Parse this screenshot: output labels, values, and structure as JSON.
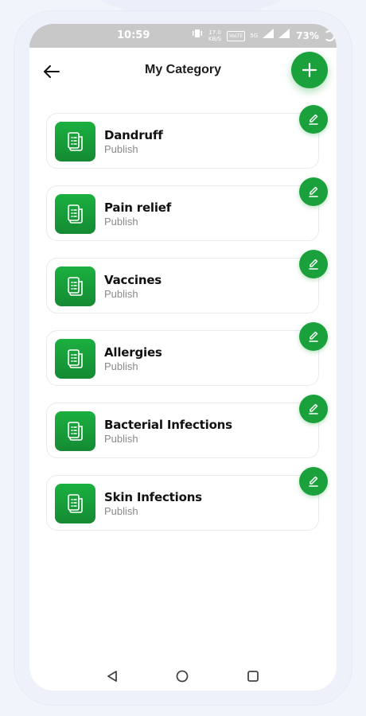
{
  "status_bar": {
    "time": "10:59",
    "net_speed": "17.0 KB/S",
    "volte": "VoLTE",
    "network": "5G",
    "battery": "73%"
  },
  "header": {
    "title": "My Category"
  },
  "categories": [
    {
      "title": "Dandruff",
      "status": "Publish"
    },
    {
      "title": "Pain relief",
      "status": "Publish"
    },
    {
      "title": "Vaccines",
      "status": "Publish"
    },
    {
      "title": "Allergies",
      "status": "Publish"
    },
    {
      "title": "Bacterial Infections",
      "status": "Publish"
    },
    {
      "title": "Skin Infections",
      "status": "Publish"
    }
  ],
  "colors": {
    "accent": "#1aa13b",
    "status_bar": "#c8c8c8",
    "muted_text": "#8a8a8a"
  },
  "icons": {
    "back": "arrow-left-icon",
    "add": "plus-icon",
    "category": "document-list-icon",
    "edit": "pencil-icon",
    "nav_back": "triangle-back-icon",
    "nav_home": "circle-home-icon",
    "nav_recent": "square-recents-icon"
  }
}
